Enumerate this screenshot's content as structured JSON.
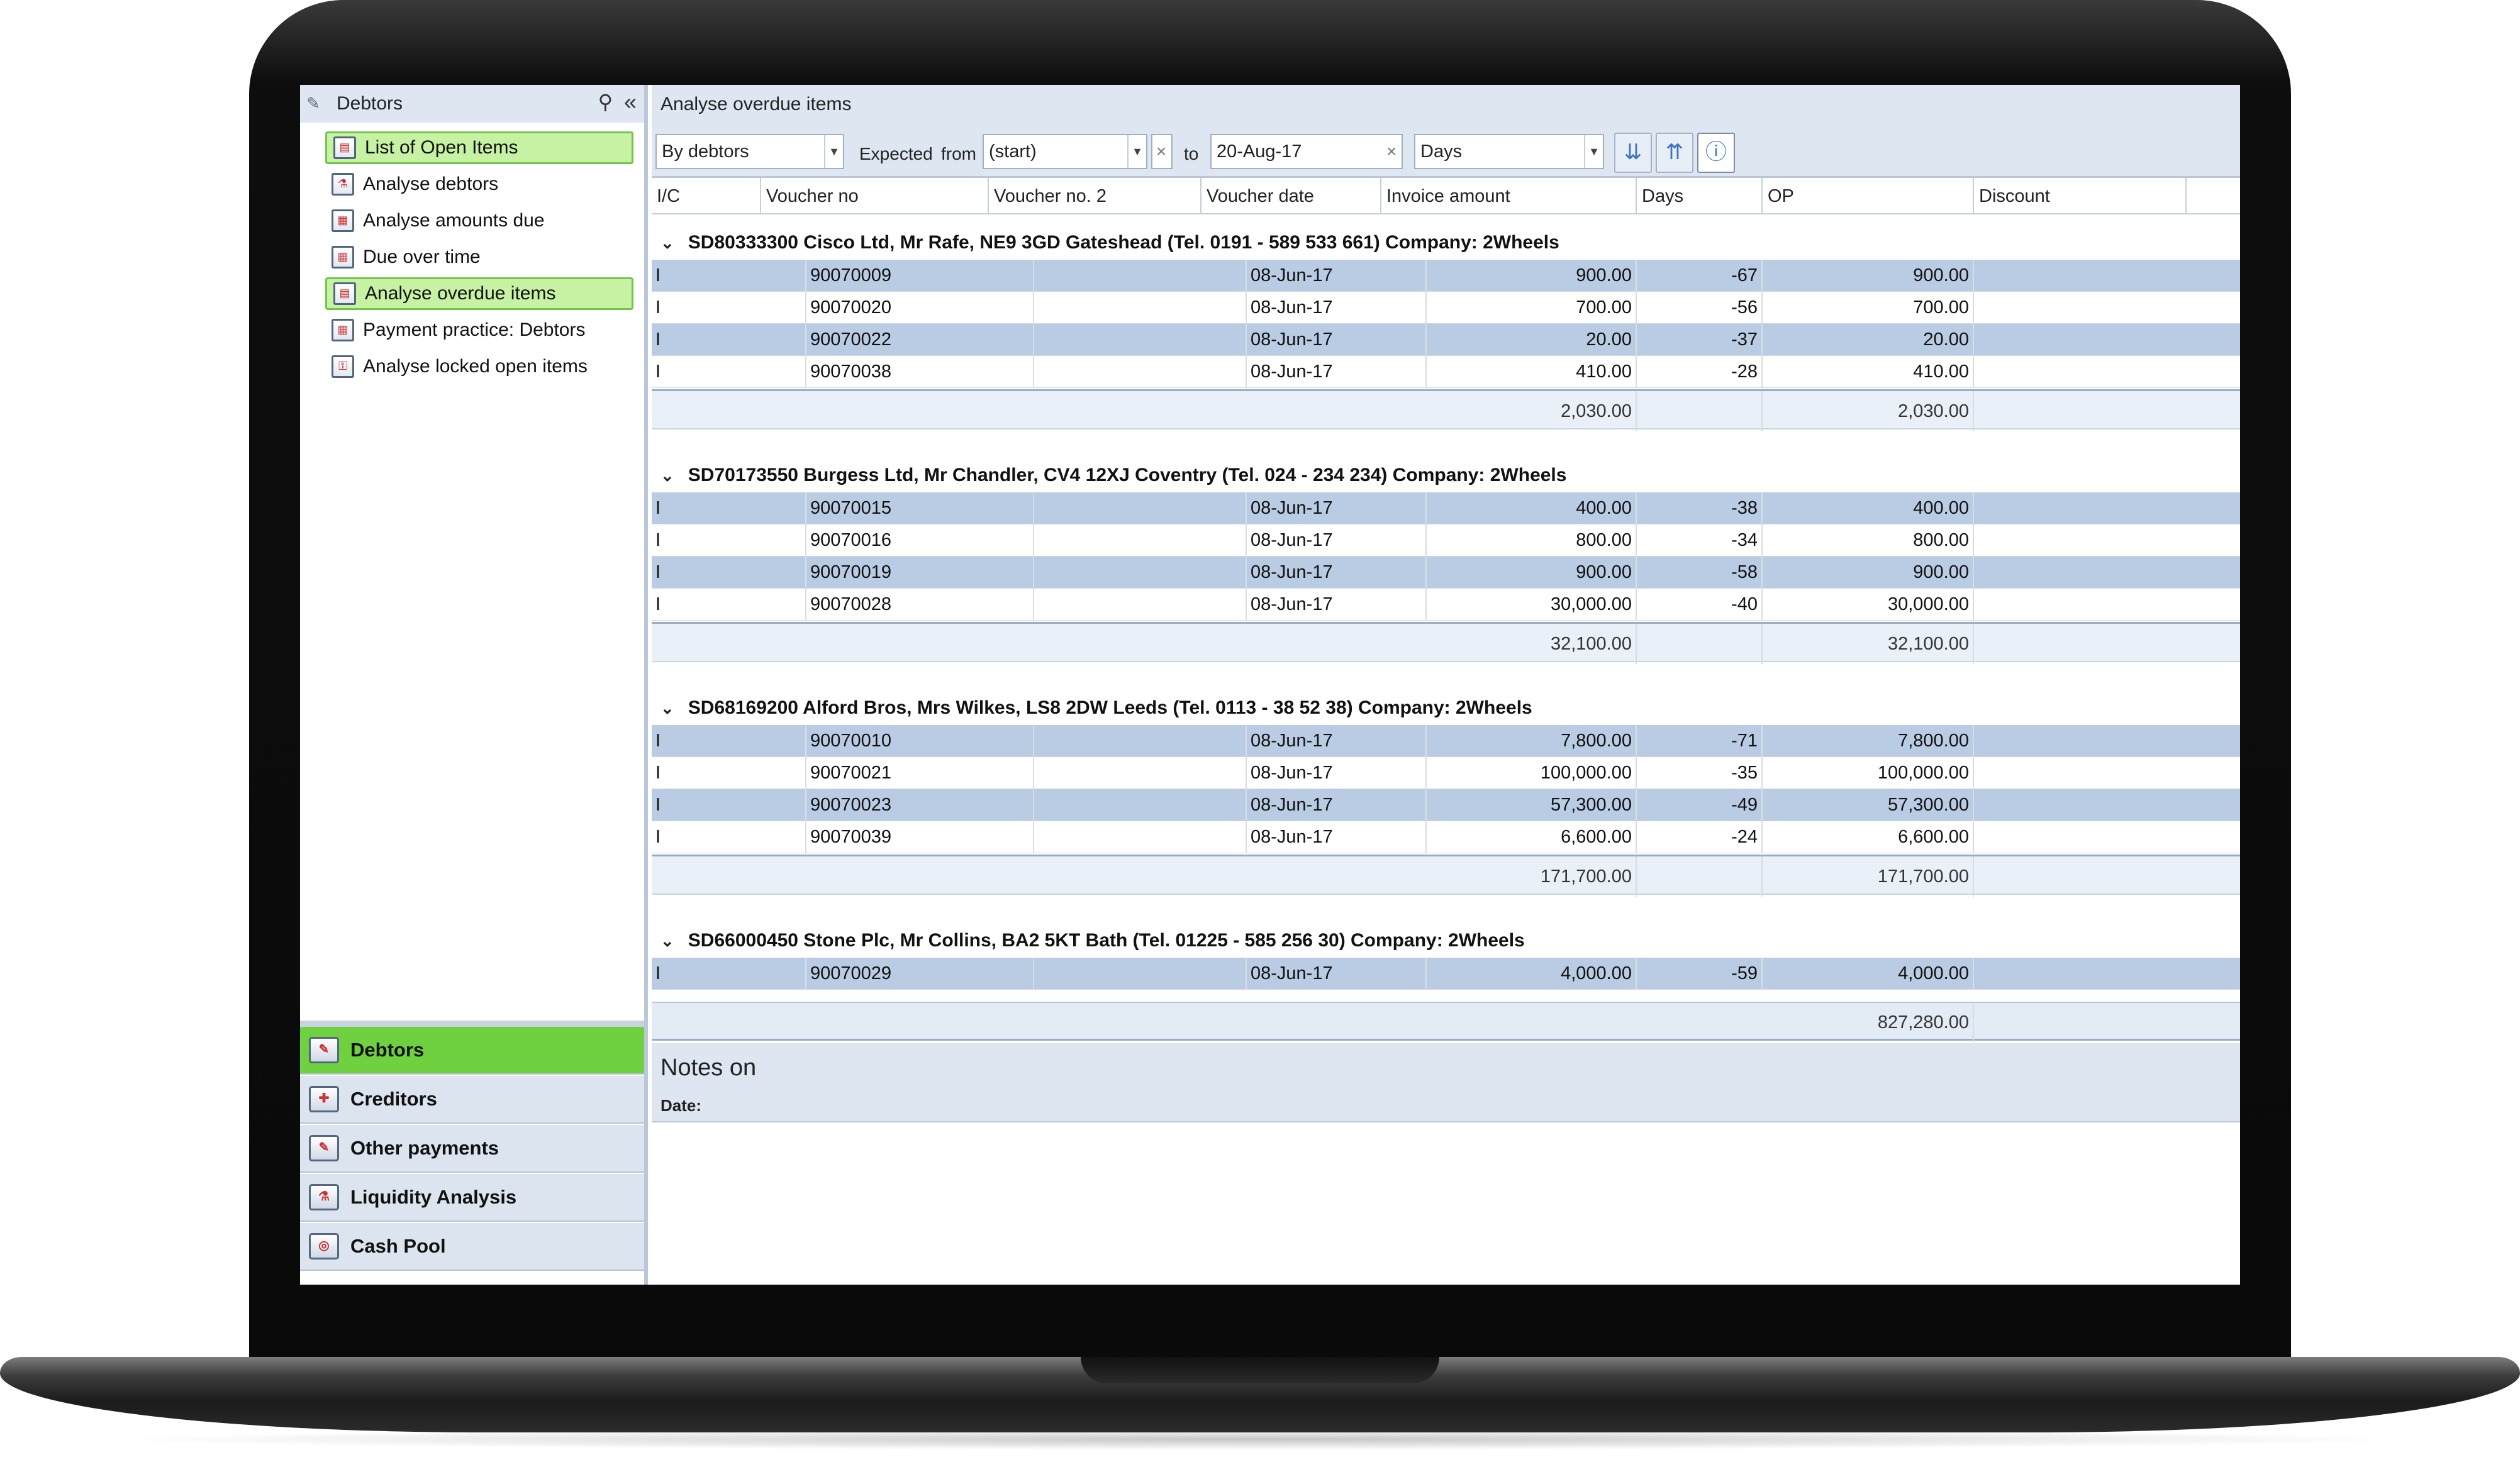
{
  "nav": {
    "header": "Debtors",
    "items": [
      {
        "label": "List of Open Items",
        "selected": true
      },
      {
        "label": "Analyse debtors",
        "selected": false
      },
      {
        "label": "Analyse amounts due",
        "selected": false
      },
      {
        "label": "Due over time",
        "selected": false
      },
      {
        "label": "Analyse overdue items",
        "selected": true
      },
      {
        "label": "Payment practice: Debtors",
        "selected": false
      },
      {
        "label": "Analyse locked open items",
        "selected": false
      }
    ],
    "modules": [
      {
        "label": "Debtors",
        "active": true
      },
      {
        "label": "Creditors",
        "active": false
      },
      {
        "label": "Other payments",
        "active": false
      },
      {
        "label": "Liquidity Analysis",
        "active": false
      },
      {
        "label": "Cash Pool",
        "active": false
      }
    ]
  },
  "main": {
    "title": "Analyse overdue items",
    "toolbar": {
      "group_by": "By debtors",
      "expected_label": "Expected",
      "from_label": "from",
      "from_value": "(start)",
      "to_label": "to",
      "to_value": "20-Aug-17",
      "unit": "Days"
    },
    "columns": [
      "I/C",
      "Voucher no",
      "Voucher no. 2",
      "Voucher date",
      "Invoice amount",
      "Days",
      "OP",
      "Discount"
    ],
    "groups": [
      {
        "title": "SD80333300 Cisco Ltd, Mr Rafe, NE9 3GD Gateshead (Tel. 0191 - 589 533 661) Company: 2Wheels",
        "rows": [
          {
            "ic": "I",
            "voucher": "90070009",
            "date": "08-Jun-17",
            "amount": "900.00",
            "days": "-67",
            "op": "900.00"
          },
          {
            "ic": "I",
            "voucher": "90070020",
            "date": "08-Jun-17",
            "amount": "700.00",
            "days": "-56",
            "op": "700.00"
          },
          {
            "ic": "I",
            "voucher": "90070022",
            "date": "08-Jun-17",
            "amount": "20.00",
            "days": "-37",
            "op": "20.00"
          },
          {
            "ic": "I",
            "voucher": "90070038",
            "date": "08-Jun-17",
            "amount": "410.00",
            "days": "-28",
            "op": "410.00"
          }
        ],
        "total_amount": "2,030.00",
        "total_op": "2,030.00"
      },
      {
        "title": "SD70173550 Burgess Ltd, Mr Chandler, CV4 12XJ Coventry (Tel. 024 - 234 234) Company: 2Wheels",
        "rows": [
          {
            "ic": "I",
            "voucher": "90070015",
            "date": "08-Jun-17",
            "amount": "400.00",
            "days": "-38",
            "op": "400.00"
          },
          {
            "ic": "I",
            "voucher": "90070016",
            "date": "08-Jun-17",
            "amount": "800.00",
            "days": "-34",
            "op": "800.00"
          },
          {
            "ic": "I",
            "voucher": "90070019",
            "date": "08-Jun-17",
            "amount": "900.00",
            "days": "-58",
            "op": "900.00"
          },
          {
            "ic": "I",
            "voucher": "90070028",
            "date": "08-Jun-17",
            "amount": "30,000.00",
            "days": "-40",
            "op": "30,000.00"
          }
        ],
        "total_amount": "32,100.00",
        "total_op": "32,100.00"
      },
      {
        "title": "SD68169200 Alford Bros, Mrs Wilkes, LS8 2DW Leeds (Tel. 0113 - 38 52 38) Company: 2Wheels",
        "rows": [
          {
            "ic": "I",
            "voucher": "90070010",
            "date": "08-Jun-17",
            "amount": "7,800.00",
            "days": "-71",
            "op": "7,800.00"
          },
          {
            "ic": "I",
            "voucher": "90070021",
            "date": "08-Jun-17",
            "amount": "100,000.00",
            "days": "-35",
            "op": "100,000.00"
          },
          {
            "ic": "I",
            "voucher": "90070023",
            "date": "08-Jun-17",
            "amount": "57,300.00",
            "days": "-49",
            "op": "57,300.00"
          },
          {
            "ic": "I",
            "voucher": "90070039",
            "date": "08-Jun-17",
            "amount": "6,600.00",
            "days": "-24",
            "op": "6,600.00"
          }
        ],
        "total_amount": "171,700.00",
        "total_op": "171,700.00"
      },
      {
        "title": "SD66000450 Stone Plc, Mr Collins, BA2 5KT Bath (Tel. 01225 - 585 256 30) Company: 2Wheels",
        "rows": [
          {
            "ic": "I",
            "voucher": "90070029",
            "date": "08-Jun-17",
            "amount": "4,000.00",
            "days": "-59",
            "op": "4,000.00"
          }
        ]
      }
    ],
    "grand_total_op": "827,280.00",
    "notes": {
      "title": "Notes on",
      "date_label": "Date:"
    }
  },
  "colors": {
    "selected_green": "#c7f1a3",
    "active_module": "#6fd040",
    "row_alt": "#b9cce3",
    "panel": "#dde6f1"
  }
}
